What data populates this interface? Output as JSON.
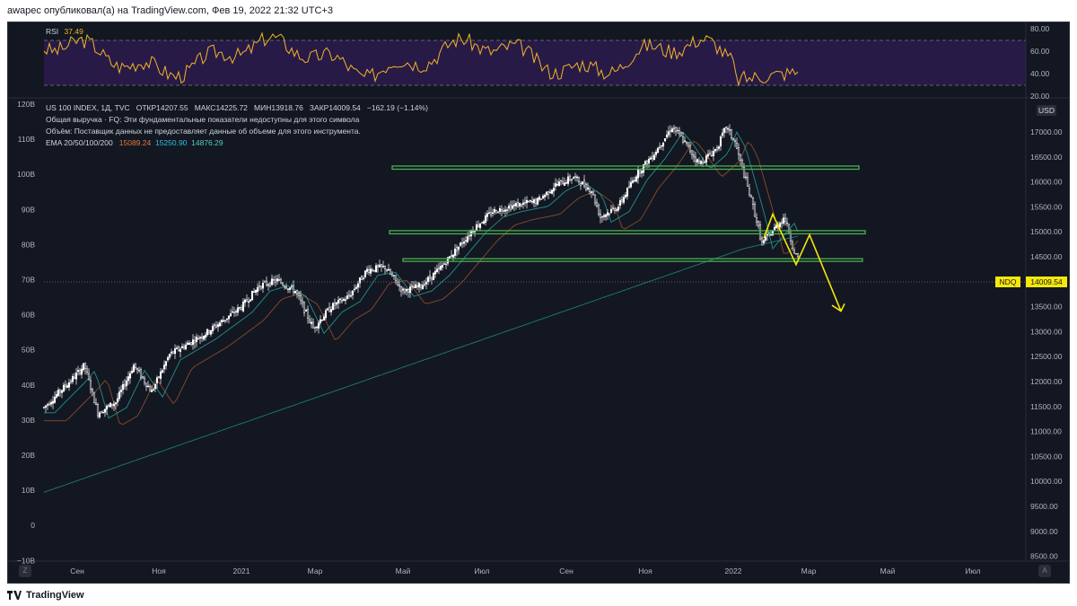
{
  "caption": "awapec опубликовал(а) на TradingView.com, Фев 19, 2022 21:32 UTC+3",
  "footer": {
    "brand": "TradingView"
  },
  "rsi": {
    "label": "RSI",
    "value": "37.49",
    "scale": [
      "80.00",
      "60.00",
      "40.00",
      "20.00"
    ]
  },
  "legend": {
    "line1": {
      "symbol": "US 100 INDEX, 1Д, TVC",
      "o_label": "ОТКР",
      "o": "14207.55",
      "h_label": "МАКС",
      "h": "14225.72",
      "l_label": "МИН",
      "l": "13918.76",
      "c_label": "ЗАКР",
      "c": "14009.54",
      "chg": "−162.19 (−1.14%)"
    },
    "line2": "Общая выручка · FQ: Эти фундаментальные показатели недоступны для этого символа",
    "line3": "Объём: Поставщик данных не предоставляет данные об объеме для этого инструмента.",
    "ema": {
      "label": "EMA 20/50/100/200",
      "v1": "15089.24",
      "v2": "15250.90",
      "v3": "14876.29"
    }
  },
  "price_axis": {
    "currency": "USD",
    "ticks": [
      "17000.00",
      "16500.00",
      "16000.00",
      "15500.00",
      "15000.00",
      "14500.00",
      "14000.00",
      "13500.00",
      "13000.00",
      "12500.00",
      "12000.00",
      "11500.00",
      "11000.00",
      "10500.00",
      "10000.00",
      "9500.00",
      "9000.00",
      "8500.00"
    ]
  },
  "volume_axis": {
    "ticks": [
      "120B",
      "110B",
      "100B",
      "90B",
      "80B",
      "70B",
      "60B",
      "50B",
      "40B",
      "30B",
      "20B",
      "10B",
      "0",
      "−10B"
    ]
  },
  "time_axis": {
    "ticks": [
      "Сен",
      "Ноя",
      "2021",
      "Мар",
      "Май",
      "Июл",
      "Сен",
      "Ноя",
      "2022",
      "Мар",
      "Май",
      "Июл"
    ]
  },
  "last_price": {
    "symbol": "NDQ",
    "value": "14009.54"
  },
  "buttons": {
    "zoom": "Z",
    "auto": "A"
  },
  "colors": {
    "background": "#131722",
    "candle": "#ffffff",
    "rsi_line": "#f0b429",
    "rsi_band": "#2d1b4e",
    "ema_orange": "#e07b39",
    "ema_teal": "#26a69a",
    "zones": "#4caf50",
    "arrow": "#f5e80a"
  },
  "chart_data": {
    "type": "candlestick",
    "symbol": "US 100 INDEX",
    "interval": "1Д",
    "ylim": [
      8500,
      17000
    ],
    "support_zones": [
      15700,
      14500,
      13990
    ],
    "projection_arrow": [
      [
        "2022-02-03",
        14900
      ],
      [
        "2022-02-17",
        13900
      ],
      [
        "2022-03-01",
        14500
      ],
      [
        "2022-03-20",
        13000
      ]
    ],
    "ema_readings": {
      "ema20": 15089.24,
      "ema50": 15250.9,
      "ema100": 14876.29
    },
    "last": {
      "open": 14207.55,
      "high": 14225.72,
      "low": 13918.76,
      "close": 14009.54,
      "change": -162.19,
      "change_pct": -1.14
    }
  }
}
